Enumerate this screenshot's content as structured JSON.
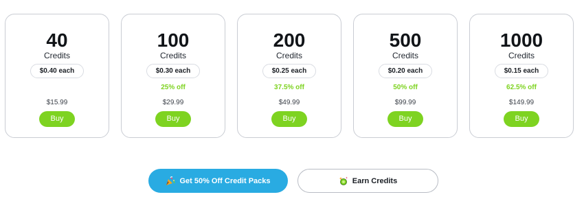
{
  "packs": [
    {
      "amount": "40",
      "unit": "Credits",
      "each": "$0.40 each",
      "discount": "",
      "price": "$15.99",
      "buy_label": "Buy"
    },
    {
      "amount": "100",
      "unit": "Credits",
      "each": "$0.30 each",
      "discount": "25% off",
      "price": "$29.99",
      "buy_label": "Buy"
    },
    {
      "amount": "200",
      "unit": "Credits",
      "each": "$0.25 each",
      "discount": "37.5% off",
      "price": "$49.99",
      "buy_label": "Buy"
    },
    {
      "amount": "500",
      "unit": "Credits",
      "each": "$0.20 each",
      "discount": "50% off",
      "price": "$99.99",
      "buy_label": "Buy"
    },
    {
      "amount": "1000",
      "unit": "Credits",
      "each": "$0.15 each",
      "discount": "62.5% off",
      "price": "$149.99",
      "buy_label": "Buy"
    }
  ],
  "actions": {
    "discount_label": "Get 50% Off Credit Packs",
    "discount_icon": "party-popper-icon",
    "earn_label": "Earn Credits",
    "earn_icon": "credits-sparkle-icon"
  },
  "colors": {
    "accent_green": "#7ed321",
    "primary_blue": "#29abe2",
    "card_border": "#c9ccd3"
  }
}
